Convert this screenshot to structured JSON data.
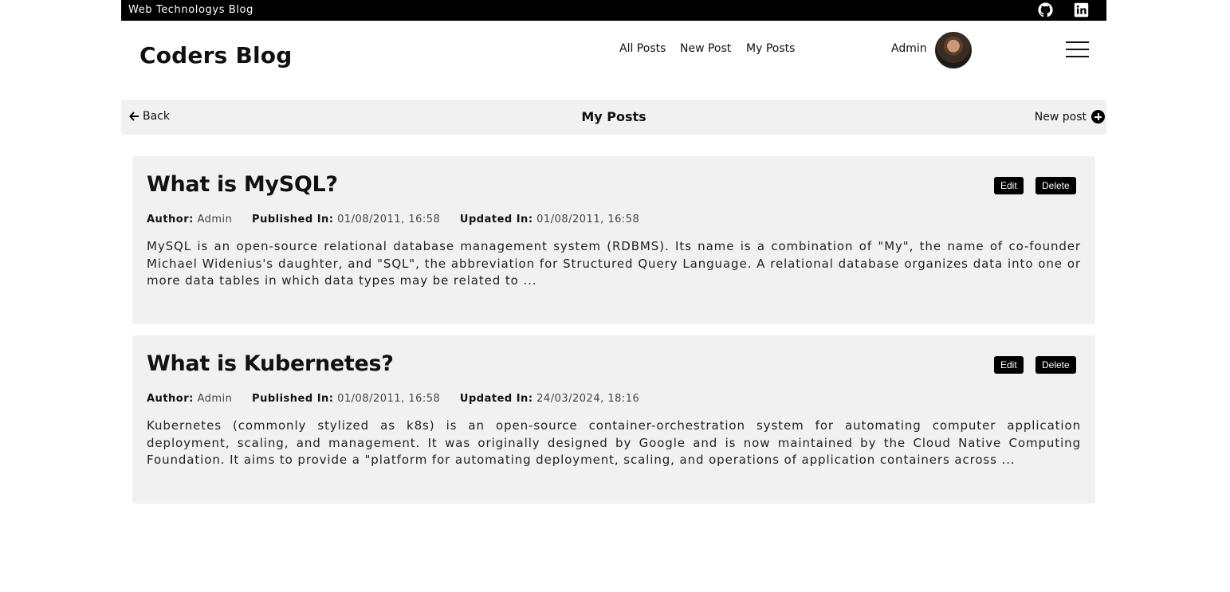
{
  "topbar": {
    "title": "Web Technologys Blog",
    "icons": [
      "github-icon",
      "linkedin-icon"
    ]
  },
  "header": {
    "brand": "Coders Blog",
    "nav": [
      "All Posts",
      "New Post",
      "My Posts"
    ],
    "user_name": "Admin"
  },
  "toolbar": {
    "back_label": "Back",
    "title": "My Posts",
    "new_post_label": "New post"
  },
  "labels": {
    "author": "Author:",
    "published": "Published In:",
    "updated": "Updated In:",
    "edit": "Edit",
    "delete": "Delete"
  },
  "posts": [
    {
      "title": "What is MySQL?",
      "author": "Admin",
      "published": "01/08/2011, 16:58",
      "updated": "01/08/2011, 16:58",
      "excerpt": "MySQL is an open-source relational database management system (RDBMS). Its name is a combination of \"My\", the name of co-founder Michael Widenius's daughter, and \"SQL\", the abbreviation for Structured Query Language. A relational database organizes data into one or more data tables in which data types may be related to ..."
    },
    {
      "title": "What is Kubernetes?",
      "author": "Admin",
      "published": "01/08/2011, 16:58",
      "updated": "24/03/2024, 18:16",
      "excerpt": "Kubernetes (commonly stylized as k8s) is an open-source container-orchestration system for automating computer application deployment, scaling, and management. It was originally designed by Google and is now maintained by the Cloud Native Computing Foundation. It aims to provide a \"platform for automating deployment, scaling, and operations of application containers across ..."
    }
  ]
}
